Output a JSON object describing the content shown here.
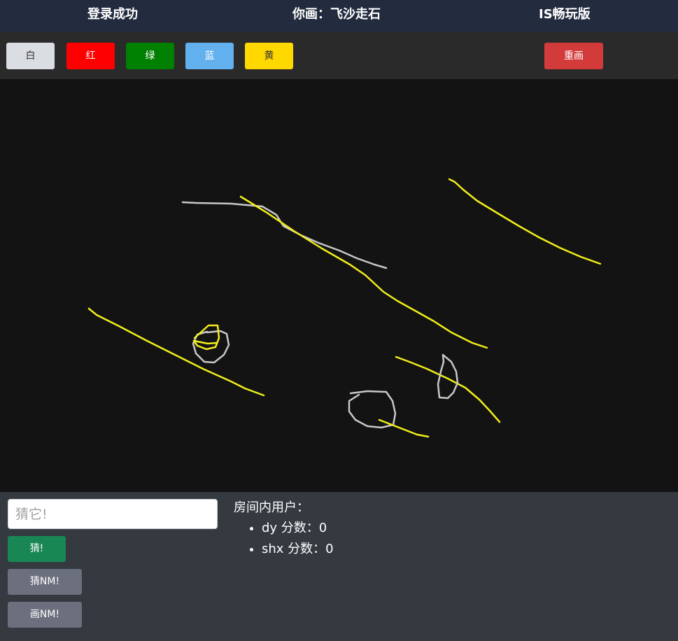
{
  "header": {
    "status": "登录成功",
    "word": "你画：飞沙走石",
    "version": "IS畅玩版"
  },
  "toolbar": {
    "colors": [
      {
        "label": "白",
        "bg": "#dadde2",
        "fg": "#333333"
      },
      {
        "label": "红",
        "bg": "#ff0000",
        "fg": "#ffffff"
      },
      {
        "label": "绿",
        "bg": "#008000",
        "fg": "#ffffff"
      },
      {
        "label": "蓝",
        "bg": "#63b0ee",
        "fg": "#ffffff"
      },
      {
        "label": "黄",
        "bg": "#ffd800",
        "fg": "#333333"
      }
    ],
    "redraw_label": "重画"
  },
  "canvas": {
    "background": "#131313",
    "stroke_colors": {
      "yellow": "#f2ee1a",
      "white": "#c8c8c8"
    }
  },
  "guess": {
    "placeholder": "猜它!",
    "guess_label": "猜!",
    "guess_nm_label": "猜NM!",
    "draw_nm_label": "画NM!"
  },
  "room": {
    "title": "房间内用户：",
    "users": [
      {
        "text": "dy 分数：0"
      },
      {
        "text": "shx 分数：0"
      }
    ]
  }
}
